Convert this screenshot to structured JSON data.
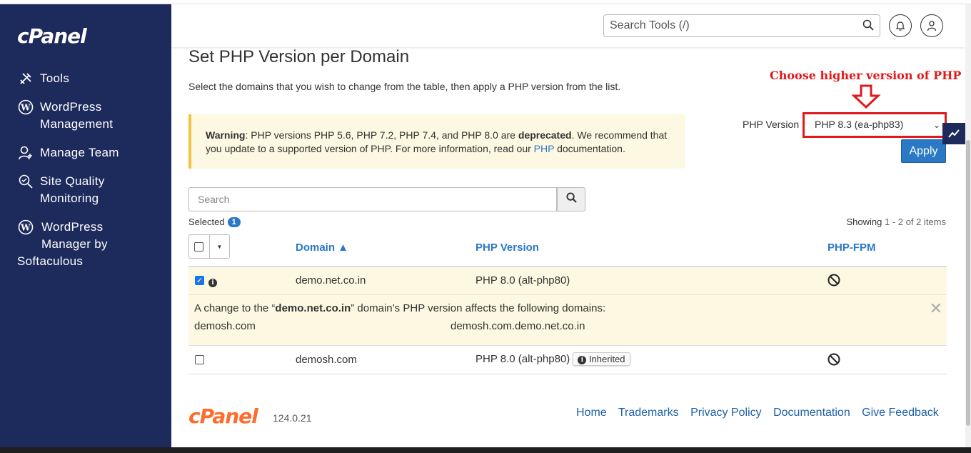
{
  "sidebar": {
    "logo": "cPanel",
    "items": [
      {
        "label": "Tools",
        "icon": "tools-icon"
      },
      {
        "label": "WordPress",
        "label2": "Management",
        "icon": "wordpress-icon"
      },
      {
        "label": "Manage Team",
        "icon": "user-plus-icon"
      },
      {
        "label": "Site Quality",
        "label2": "Monitoring",
        "icon": "search-quality-icon"
      },
      {
        "label": "WordPress",
        "label2": "Manager by",
        "label3": "Softaculous",
        "icon": "wordpress-icon"
      }
    ]
  },
  "topbar": {
    "search_placeholder": "Search Tools (/)"
  },
  "page": {
    "title": "Set PHP Version per Domain",
    "description": "Select the domains that you wish to change from the table, then apply a PHP version from the list.",
    "warning_label": "Warning",
    "warning_text_1": ": PHP versions PHP 5.6, PHP 7.2, PHP 7.4, and PHP 8.0 are ",
    "warning_bold": "deprecated",
    "warning_text_2": ". We recommend that you update to a supported version of PHP. For more information, read our ",
    "warning_link": "PHP",
    "warning_text_3": " documentation."
  },
  "annotation": {
    "text": "Choose higher version of PHP",
    "color": "#e0191b"
  },
  "php_selector": {
    "label": "PHP Version",
    "selected": "PHP 8.3 (ea-php83)",
    "apply_label": "Apply"
  },
  "table": {
    "search_placeholder": "Search",
    "selected_label": "Selected",
    "selected_count": "1",
    "showing_label": "Showing",
    "showing_range": "1 - 2 of 2 items",
    "columns": [
      "Domain ▲",
      "PHP Version",
      "PHP-FPM"
    ],
    "rows": [
      {
        "domain": "demo.net.co.in",
        "php_version": "PHP 8.0 (alt-php80)",
        "checked": true
      },
      {
        "domain": "demosh.com",
        "php_version": "PHP 8.0 (alt-php80)",
        "checked": false,
        "badge": "Inherited"
      }
    ],
    "expand": {
      "text_1": "A change to the “",
      "domain": "demo.net.co.in",
      "text_2": "” domain’s PHP version affects the following domains:",
      "affected": [
        "demosh.com",
        "demosh.com.demo.net.co.in"
      ]
    }
  },
  "footer": {
    "logo": "cPanel",
    "version": "124.0.21",
    "links": [
      "Home",
      "Trademarks",
      "Privacy Policy",
      "Documentation",
      "Give Feedback"
    ]
  }
}
